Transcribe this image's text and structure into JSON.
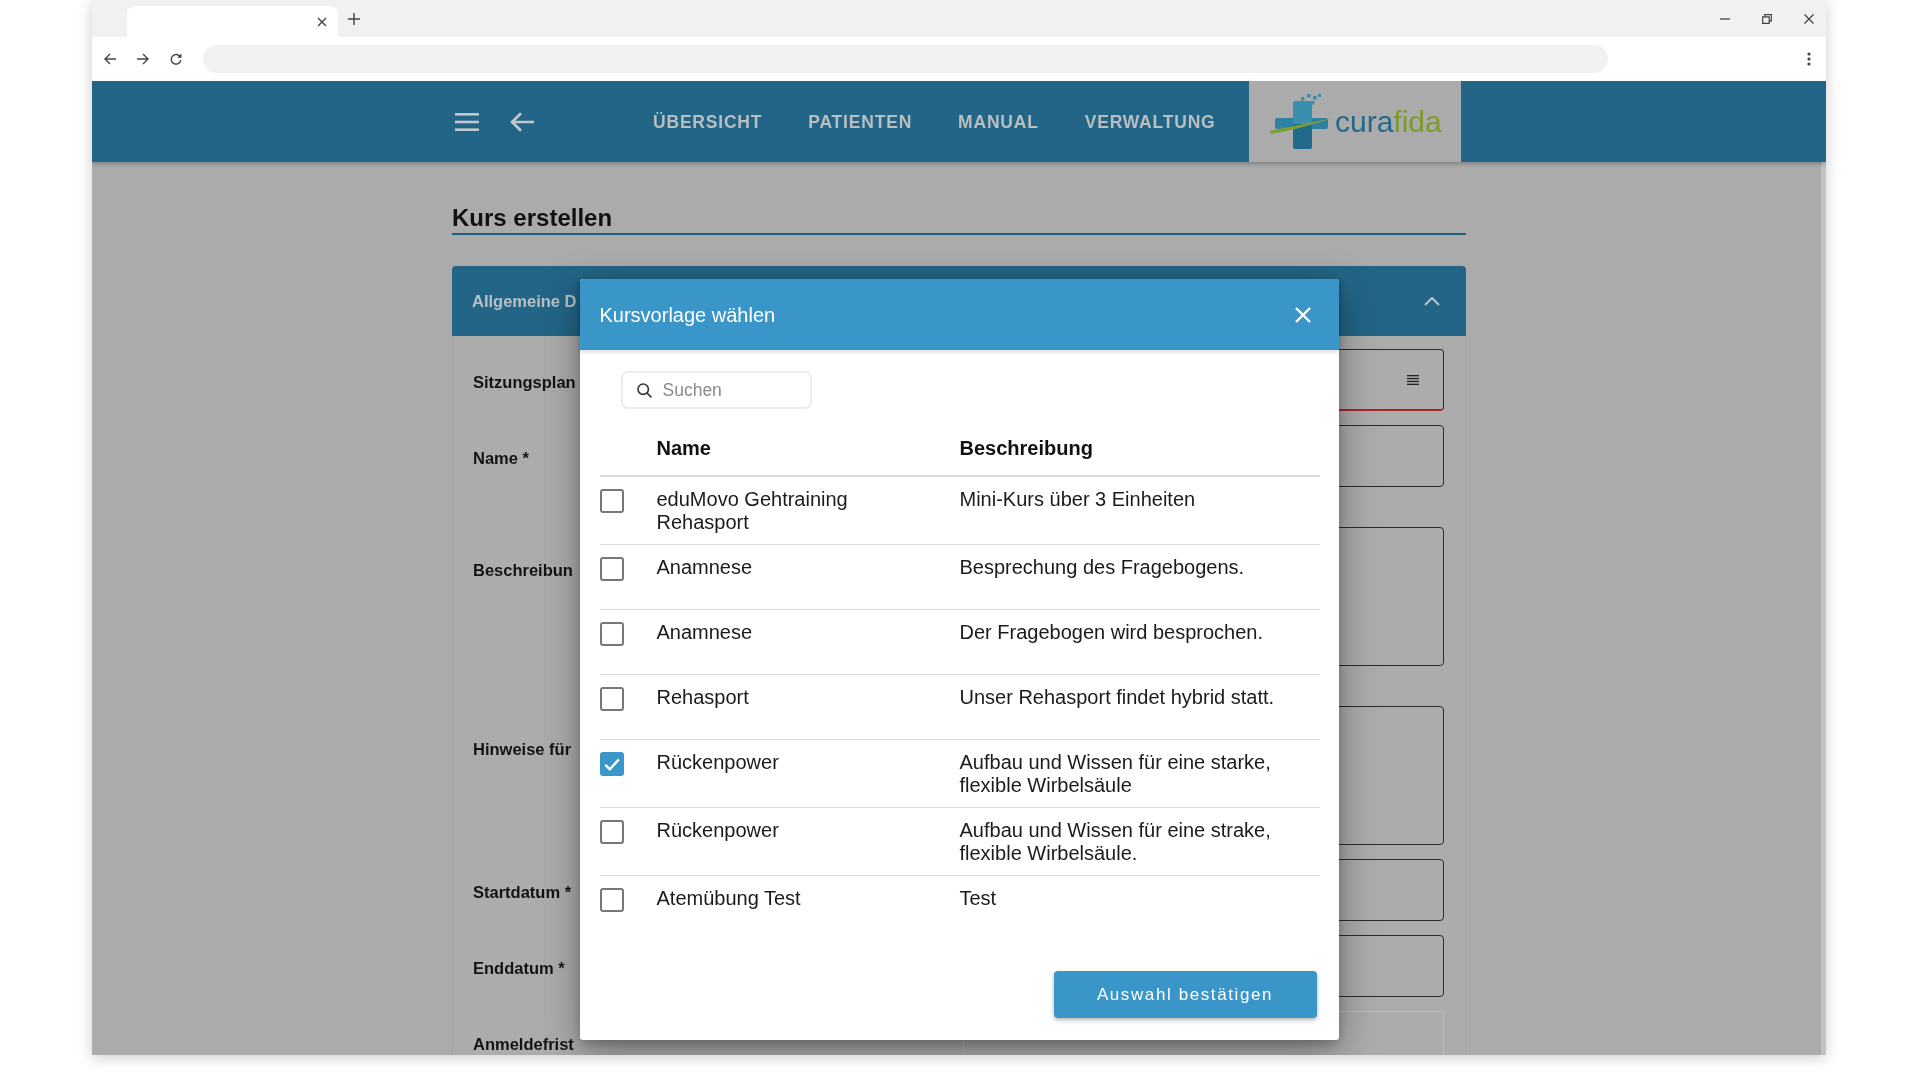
{
  "app_header": {
    "nav": [
      {
        "label": "ÜBERSICHT"
      },
      {
        "label": "PATIENTEN"
      },
      {
        "label": "MANUAL"
      },
      {
        "label": "VERWALTUNG"
      }
    ],
    "logo": {
      "wordmark_start": "cura",
      "wordmark_end": "fida"
    }
  },
  "page": {
    "title": "Kurs erstellen",
    "section": {
      "title": "Allgemeine D",
      "expanded": true,
      "fields": [
        {
          "label": "Sitzungsplan",
          "kind": "select",
          "invalid": true,
          "disabled": false
        },
        {
          "label": "Name *",
          "kind": "text",
          "invalid": false,
          "disabled": false
        },
        {
          "label": "Beschreibun",
          "kind": "textarea",
          "invalid": false,
          "disabled": false
        },
        {
          "label": "Hinweise für",
          "kind": "textarea",
          "invalid": false,
          "disabled": false
        },
        {
          "label": "Startdatum *",
          "kind": "text",
          "invalid": false,
          "disabled": false
        },
        {
          "label": "Enddatum *",
          "kind": "text",
          "invalid": false,
          "disabled": false
        },
        {
          "label": "Anmeldefrist",
          "kind": "text",
          "invalid": false,
          "disabled": true
        }
      ]
    }
  },
  "dialog": {
    "title": "Kursvorlage wählen",
    "search": {
      "placeholder": "Suchen"
    },
    "table": {
      "columns": [
        "Name",
        "Beschreibung"
      ],
      "rows": [
        {
          "name": "eduMovo Gehtraining Rehasport",
          "description": "Mini-Kurs über 3 Einheiten",
          "selected": false
        },
        {
          "name": "Anamnese",
          "description": "Besprechung des Fragebogens.",
          "selected": false
        },
        {
          "name": "Anamnese",
          "description": "Der Fragebogen wird besprochen.",
          "selected": false
        },
        {
          "name": "Rehasport",
          "description": "Unser Rehasport findet hybrid statt.",
          "selected": false
        },
        {
          "name": "Rückenpower",
          "description": "Aufbau und Wissen für eine starke, flexible Wirbelsäule",
          "selected": true
        },
        {
          "name": "Rückenpower",
          "description": "Aufbau und Wissen für eine strake, flexible Wirbelsäule.",
          "selected": false
        },
        {
          "name": "Atemübung Test",
          "description": "Test",
          "selected": false
        }
      ]
    },
    "confirm_button": "Auswahl bestätigen"
  }
}
